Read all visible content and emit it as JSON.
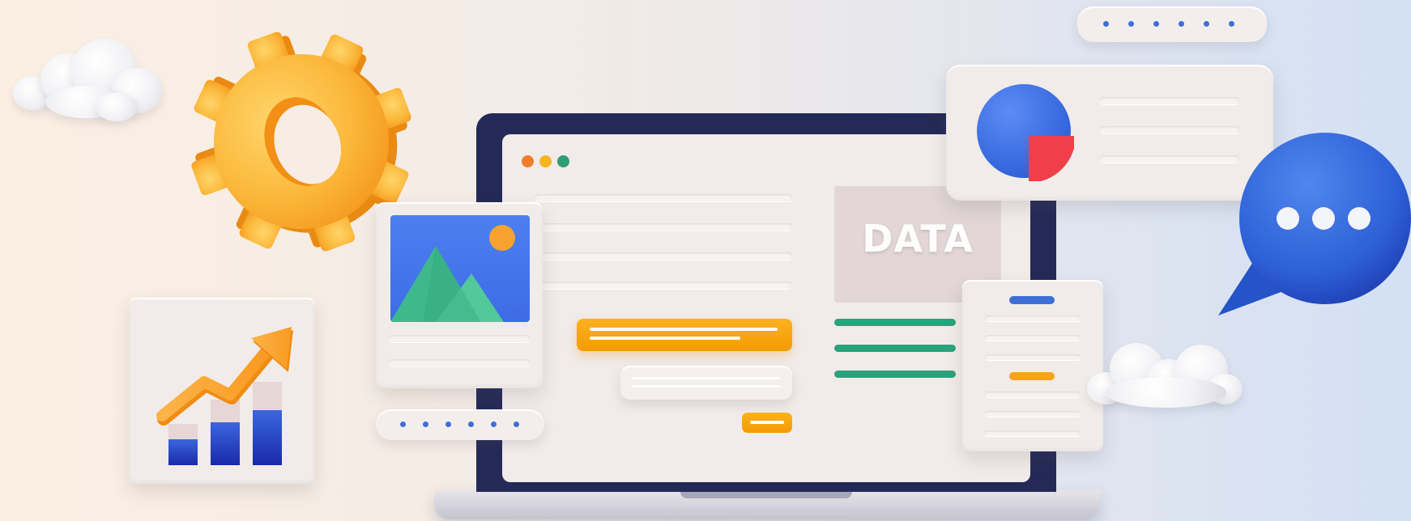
{
  "illustration": {
    "data_label": "DATA",
    "bubble_dots": "•••"
  },
  "colors": {
    "accent_orange": "#f7a21a",
    "accent_blue": "#3d6fd6",
    "accent_green": "#2aa27c",
    "pie_red": "#ee3f4a",
    "laptop_frame": "#242a57",
    "gear_yellow": "#fbb93c"
  },
  "icons": [
    "gear-icon",
    "cloud-icon",
    "chart-growth-icon",
    "image-icon",
    "pie-chart-icon",
    "chat-bubble-icon"
  ]
}
